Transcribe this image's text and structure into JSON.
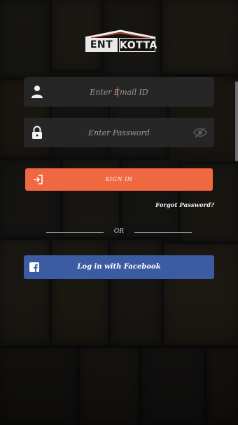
{
  "app": {
    "logo_ent": "ENT",
    "logo_kotta": "KOTTA"
  },
  "email": {
    "placeholder": "Enter Email ID",
    "value": ""
  },
  "password": {
    "placeholder": "Enter Password",
    "value": ""
  },
  "signin": {
    "label": "SIGN IN"
  },
  "forgot": {
    "label": "Forgot Password?"
  },
  "divider": {
    "label": "OR"
  },
  "facebook": {
    "label": "Log in with Facebook"
  },
  "icons": {
    "email_field": "user-icon",
    "password_field": "lock-icon",
    "password_toggle": "eye-icon",
    "signin": "sign-in-icon",
    "facebook": "facebook-icon"
  },
  "colors": {
    "accent": "#f0683f",
    "facebook": "#3b5ba3",
    "field_bg": "#282828"
  }
}
